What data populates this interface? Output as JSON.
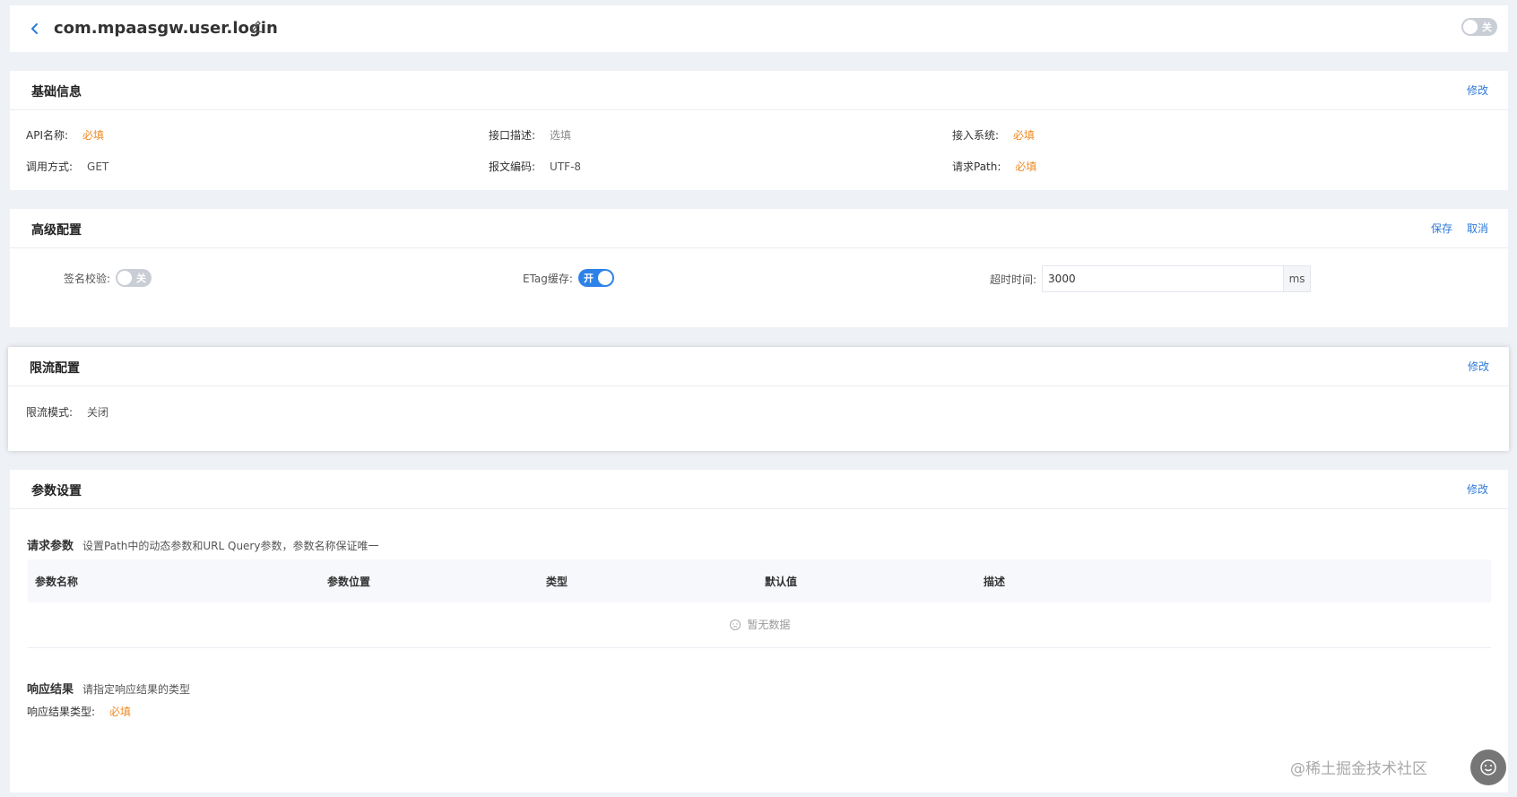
{
  "header": {
    "title": "com.mpaasgw.user.login",
    "toggle_label": "关"
  },
  "basic_info": {
    "title": "基础信息",
    "edit_label": "修改",
    "fields": {
      "api_name_label": "API名称:",
      "api_name_value": "必填",
      "desc_label": "接口描述:",
      "desc_value": "选填",
      "system_label": "接入系统:",
      "system_value": "必填",
      "method_label": "调用方式:",
      "method_value": "GET",
      "encoding_label": "报文编码:",
      "encoding_value": "UTF-8",
      "path_label": "请求Path:",
      "path_value": "必填"
    }
  },
  "advanced": {
    "title": "高级配置",
    "save_label": "保存",
    "cancel_label": "取消",
    "sign_label": "签名校验:",
    "sign_toggle": "关",
    "etag_label": "ETag缓存:",
    "etag_toggle": "开",
    "timeout_label": "超时时间:",
    "timeout_value": "3000",
    "timeout_unit": "ms"
  },
  "rate_limit": {
    "title": "限流配置",
    "edit_label": "修改",
    "mode_label": "限流模式:",
    "mode_value": "关闭"
  },
  "params": {
    "title": "参数设置",
    "edit_label": "修改",
    "request_title": "请求参数",
    "request_hint": "设置Path中的动态参数和URL Query参数，参数名称保证唯一",
    "columns": [
      "参数名称",
      "参数位置",
      "类型",
      "默认值",
      "描述"
    ],
    "empty_text": "暂无数据",
    "response_title": "响应结果",
    "response_hint": "请指定响应结果的类型",
    "response_type_label": "响应结果类型:",
    "response_type_value": "必填"
  },
  "watermark": "@稀土掘金技术社区",
  "colors": {
    "accent": "#2d7ad6",
    "required": "#f08a24",
    "toggle_on": "#2d82e8",
    "toggle_off": "#c9ced6"
  }
}
